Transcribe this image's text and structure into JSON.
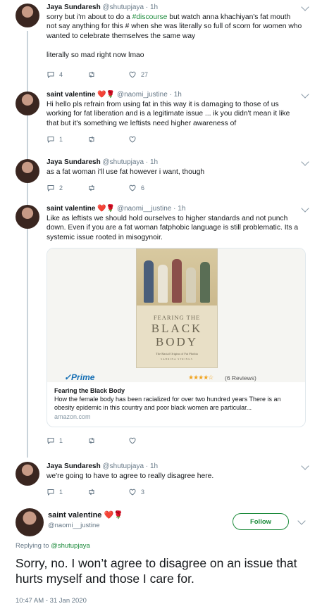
{
  "tweets": [
    {
      "name": "Jaya Sundaresh",
      "handle": "@shutupjaya",
      "time": "1h",
      "text_before": "sorry but i'm about to do a ",
      "hashtag": "#discourse",
      "text_after": " but watch anna khachiyan's fat mouth not say anything for this # when she was literally so full of scorn for women who wanted to celebrate themselves the same way",
      "text_extra": "literally so mad right now lmao",
      "replies": "4",
      "retweets": "",
      "likes": "27"
    },
    {
      "name": "saint valentine",
      "hearts": "❤️🌹",
      "handle": "@naomi_justine",
      "time": "1h",
      "text": "Hi hello pls refrain from using fat in this way it is damaging to those of us working for fat liberation and is a legitimate issue ... ik you didn't mean it like that but it's something we leftists need higher awareness of",
      "replies": "1",
      "retweets": "",
      "likes": ""
    },
    {
      "name": "Jaya Sundaresh",
      "handle": "@shutupjaya",
      "time": "1h",
      "text": "as a fat woman i'll use fat however i want, though",
      "replies": "2",
      "retweets": "",
      "likes": "6"
    },
    {
      "name": "saint valentine",
      "hearts": "❤️🌹",
      "handle": "@naomi__justine",
      "time": "1h",
      "text": "Like as leftists we should hold ourselves to higher standards and not punch down. Even if you are a fat woman fatphobic language is still problematic. Its a systemic issue rooted in misogynoir.",
      "replies": "1",
      "retweets": "",
      "likes": ""
    },
    {
      "name": "Jaya Sundaresh",
      "handle": "@shutupjaya",
      "time": "1h",
      "text": "we're going to have to agree to really disagree here.",
      "replies": "1",
      "retweets": "",
      "likes": "3"
    }
  ],
  "card": {
    "book_title_1": "FEARING THE",
    "book_title_2": "BLACK",
    "book_title_3": "BODY",
    "book_subtitle": "The Racial Origins of Fat Phobia",
    "book_author": "SABRINA STRINGS",
    "prime": "✓Prime",
    "stars": "★★★★☆",
    "reviews": "(6 Reviews)",
    "title": "Fearing the Black Body",
    "desc": "How the female body has been racialized for over two hundred years There is an obesity epidemic in this country and poor black women are particular...",
    "domain": "amazon.com"
  },
  "main": {
    "name": "saint valentine",
    "hearts": "❤️🌹",
    "handle": "@naomi__justine",
    "follow_label": "Follow",
    "replying_prefix": "Replying to ",
    "replying_handle": "@shutupjaya",
    "text": "Sorry, no. I won’t agree to disagree on an issue that hurts myself and those I care for.",
    "timestamp": "10:47 AM - 31 Jan 2020"
  },
  "colors": {
    "accent": "#1b8a3a",
    "muted": "#657786",
    "thread": "#c9d3da"
  }
}
